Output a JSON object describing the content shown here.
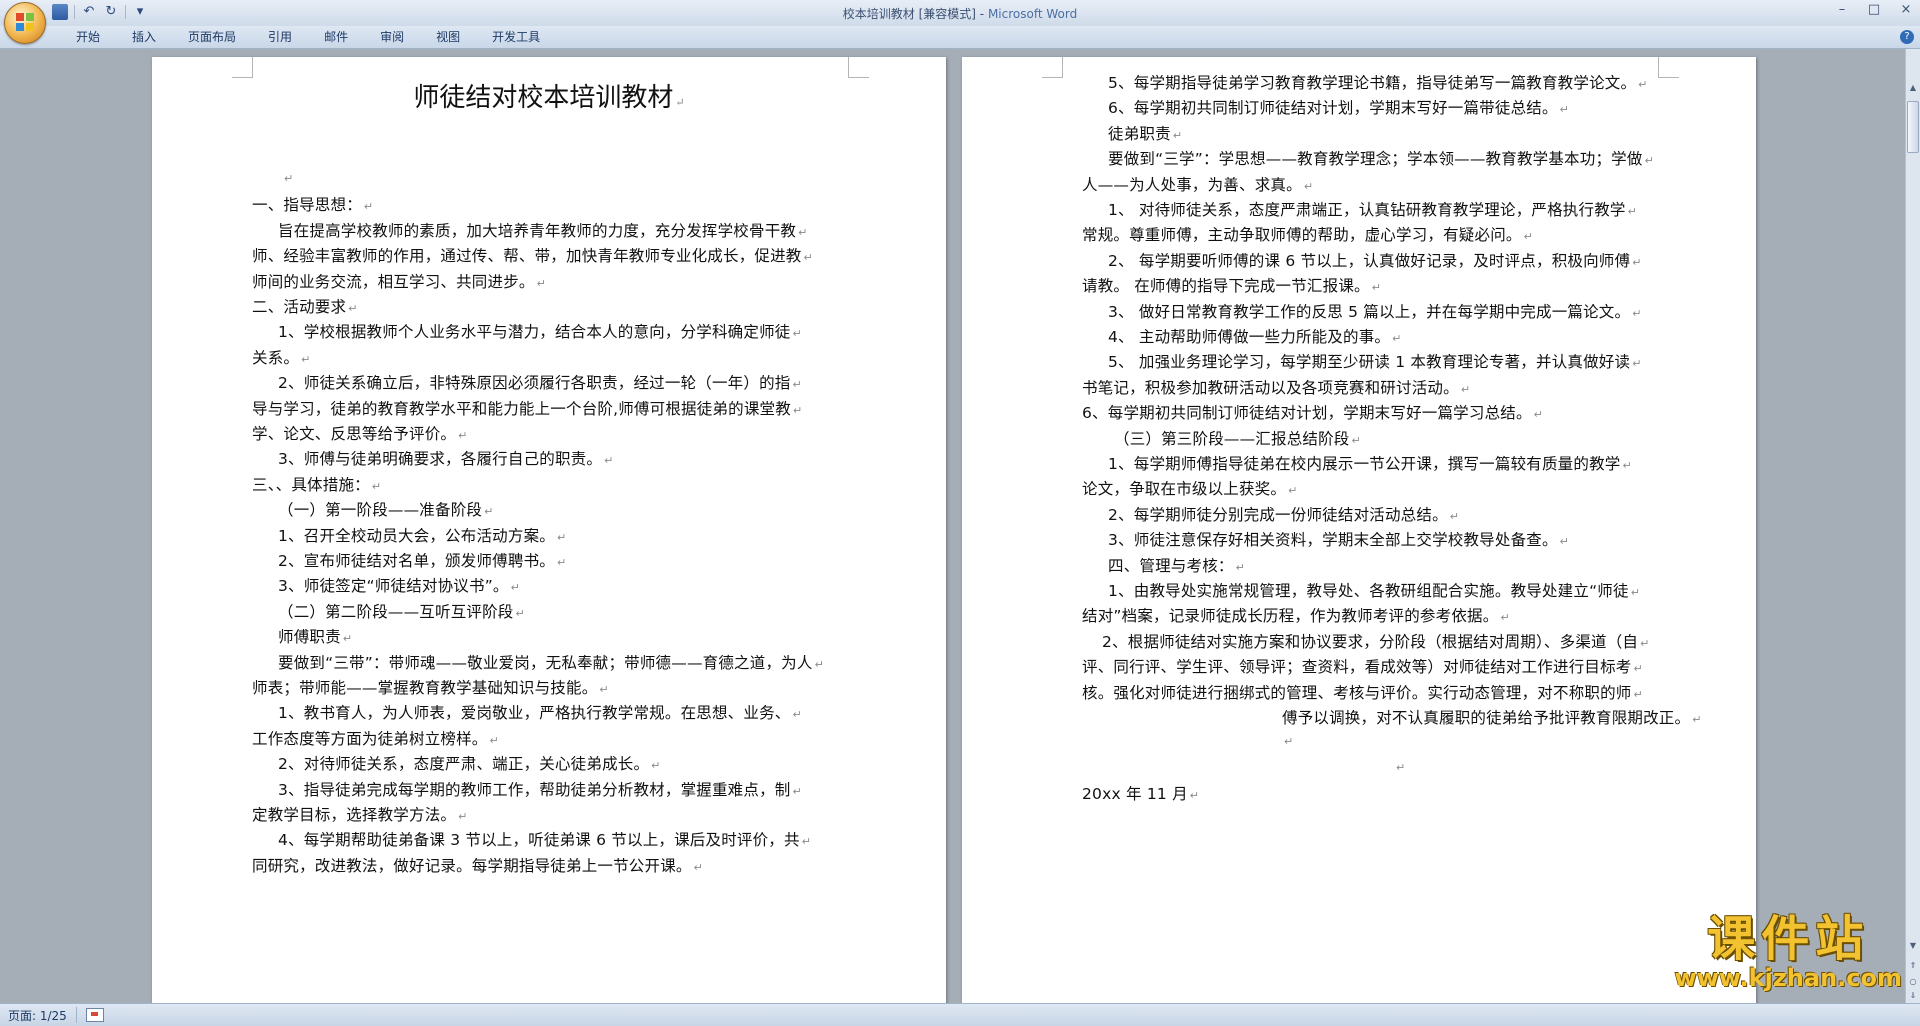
{
  "window": {
    "title": "校本培训教材 [兼容模式]",
    "title_sep": " - ",
    "app": "Microsoft Word",
    "controls": [
      "–",
      "□",
      "×"
    ]
  },
  "qat": {
    "save_icon": "save-icon",
    "undo_icon": "↶",
    "redo_icon": "↻",
    "menu_icon": "▾"
  },
  "ribbon": {
    "tabs": [
      "开始",
      "插入",
      "页面布局",
      "引用",
      "邮件",
      "审阅",
      "视图",
      "开发工具"
    ],
    "help": "?"
  },
  "document": {
    "title": "师徒结对校本培训教材",
    "left_lines": [
      "",
      "一、指导思想：",
      "旨在提高学校教师的素质，加大培养青年教师的力度，充分发挥学校骨干教",
      "师、经验丰富教师的作用，通过传、帮、带，加快青年教师专业化成长，促进教",
      "师间的业务交流，相互学习、共同进步。",
      "二、活动要求",
      "1、学校根据教师个人业务水平与潜力，结合本人的意向，分学科确定师徒",
      "关系。",
      "2、师徒关系确立后，非特殊原因必须履行各职责，经过一轮（一年）的指",
      "导与学习，徒弟的教育教学水平和能力能上一个台阶,师傅可根据徒弟的课堂教",
      "学、论文、反思等给予评价。",
      "3、师傅与徒弟明确要求，各履行自己的职责。",
      "三、、具体措施：",
      "（一）第一阶段——准备阶段",
      "1、召开全校动员大会，公布活动方案。",
      "2、宣布师徒结对名单，颁发师傅聘书。",
      "3、师徒签定“师徒结对协议书”。",
      "（二）第二阶段——互听互评阶段",
      "师傅职责",
      "要做到“三带”：带师魂——敬业爱岗，无私奉献；带师德——育德之道，为人",
      "师表；带师能——掌握教育教学基础知识与技能。",
      "1、教书育人，为人师表，爱岗敬业，严格执行教学常规。在思想、业务、",
      "工作态度等方面为徒弟树立榜样。",
      "2、对待师徒关系，态度严肃、端正，关心徒弟成长。",
      "3、指导徒弟完成每学期的教师工作，帮助徒弟分析教材，掌握重难点，制",
      "定教学目标，选择教学方法。",
      "4、每学期帮助徒弟备课 3 节以上，听徒弟课 6 节以上，课后及时评价，共",
      "同研究，改进教法，做好记录。每学期指导徒弟上一节公开课。"
    ],
    "right_lines": [
      "5、每学期指导徒弟学习教育教学理论书籍，指导徒弟写一篇教育教学论文。",
      "6、每学期初共同制订师徒结对计划，学期末写好一篇带徒总结。",
      "徒弟职责",
      "要做到“三学”：学思想——教育教学理念；学本领——教育教学基本功；学做",
      "人——为人处事，为善、求真。",
      "1、 对待师徒关系，态度严肃端正，认真钻研教育教学理论，严格执行教学",
      "常规。尊重师傅，主动争取师傅的帮助，虚心学习，有疑必问。",
      "2、 每学期要听师傅的课 6 节以上，认真做好记录，及时评点，积极向师傅",
      "请教。 在师傅的指导下完成一节汇报课。",
      "3、 做好日常教育教学工作的反思 5 篇以上，并在每学期中完成一篇论文。",
      "4、 主动帮助师傅做一些力所能及的事。",
      "5、 加强业务理论学习，每学期至少研读 1 本教育理论专著，并认真做好读",
      "书笔记，积极参加教研活动以及各项竞赛和研讨活动。",
      "6、每学期初共同制订师徒结对计划，学期末写好一篇学习总结。",
      "（三）第三阶段——汇报总结阶段",
      "1、每学期师傅指导徒弟在校内展示一节公开课，撰写一篇较有质量的教学",
      "论文，争取在市级以上获奖。",
      "2、每学期师徒分别完成一份师徒结对活动总结。",
      "3、师徒注意保存好相关资料，学期末全部上交学校教导处备查。",
      "四、管理与考核：",
      "1、由教导处实施常规管理，教导处、各教研组配合实施。教导处建立“师徒",
      "结对”档案，记录师徒成长历程，作为教师考评的参考依据。",
      "2、根据师徒结对实施方案和协议要求，分阶段（根据结对周期）、多渠道（自",
      "评、同行评、学生评、领导评；查资料，看成效等）对师徒结对工作进行目标考",
      "核。强化对师徒进行捆绑式的管理、考核与评价。实行动态管理，对不称职的师",
      "傅予以调换，对不认真履职的徒弟给予批评教育限期改正。",
      "",
      "",
      "20xx 年 11 月"
    ],
    "paragraph_mark": "↵"
  },
  "statusbar": {
    "page": "页面: 1/25"
  },
  "watermark": {
    "main": "课件站",
    "url": "www.kjzhan.com"
  }
}
